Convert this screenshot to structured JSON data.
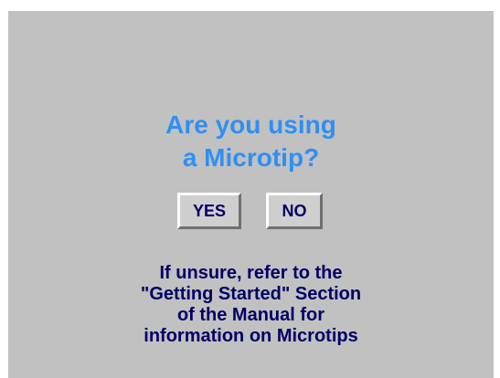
{
  "dialog": {
    "question_lines": [
      "Are you using",
      "a Microtip?"
    ],
    "yes_label": "YES",
    "no_label": "NO",
    "info_lines": [
      "If unsure, refer to the",
      "\"Getting Started\" Section",
      "of the Manual for",
      "information on Microtips"
    ],
    "colors": {
      "background": "#c1c1c1",
      "question_text": "#2f8ff3",
      "body_text": "#000066",
      "button_face": "#cfcfcf"
    }
  }
}
